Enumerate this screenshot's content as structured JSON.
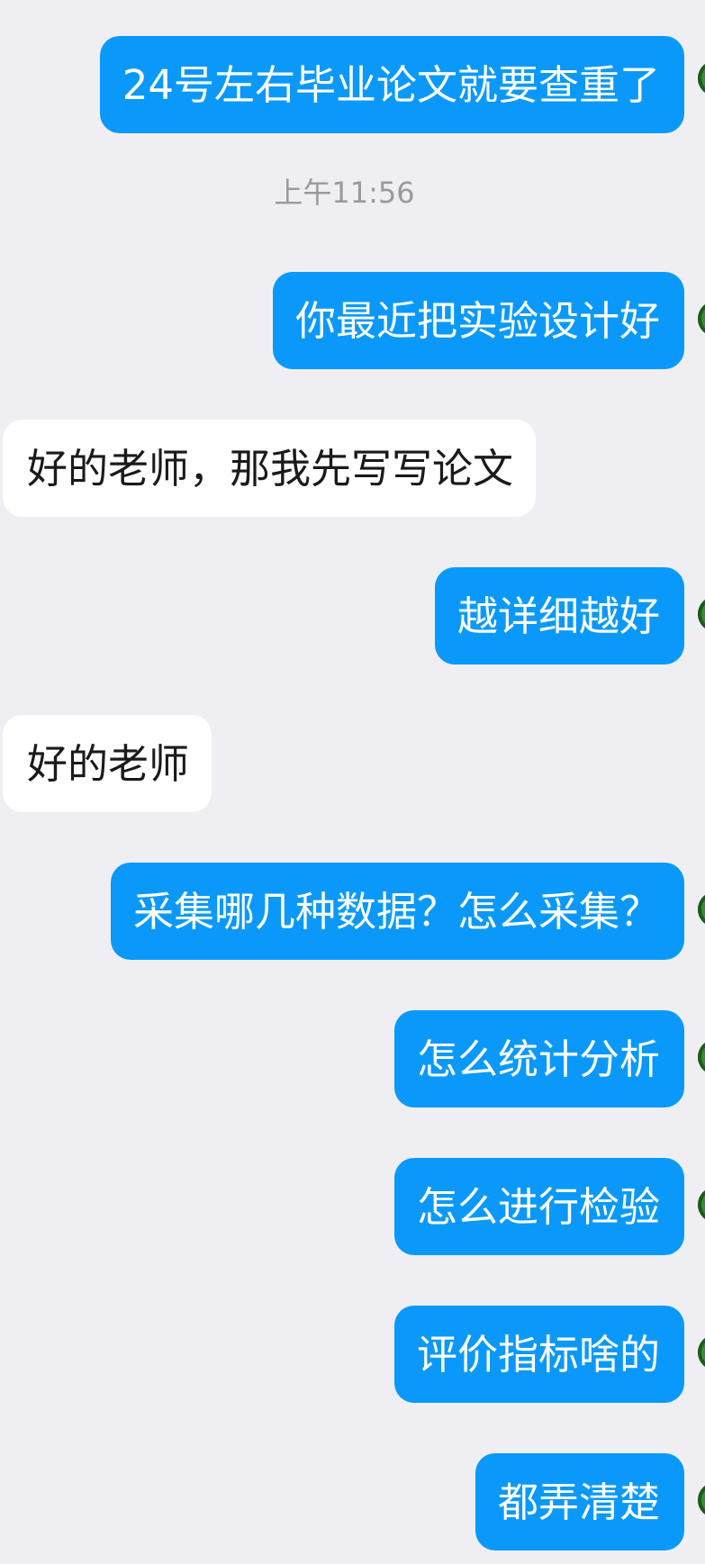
{
  "chat": {
    "messages": [
      {
        "role": "sent",
        "text": "24号左右毕业论文就要查重了"
      },
      {
        "role": "time",
        "text": "上午11:56"
      },
      {
        "role": "sent",
        "text": "你最近把实验设计好"
      },
      {
        "role": "received",
        "text": "好的老师，那我先写写论文"
      },
      {
        "role": "sent",
        "text": "越详细越好"
      },
      {
        "role": "received",
        "text": "好的老师"
      },
      {
        "role": "sent",
        "text": "采集哪几种数据？怎么采集？"
      },
      {
        "role": "sent",
        "text": "怎么统计分析"
      },
      {
        "role": "sent",
        "text": "怎么进行检验"
      },
      {
        "role": "sent",
        "text": "评价指标啥的"
      },
      {
        "role": "sent",
        "text": "都弄清楚"
      }
    ]
  },
  "colors": {
    "background": "#efeff3",
    "sent_bubble": "#0a99fb",
    "received_bubble": "#ffffff",
    "sent_text": "#ffffff",
    "received_text": "#1a1a1a",
    "timestamp_text": "#9a9a9a"
  }
}
